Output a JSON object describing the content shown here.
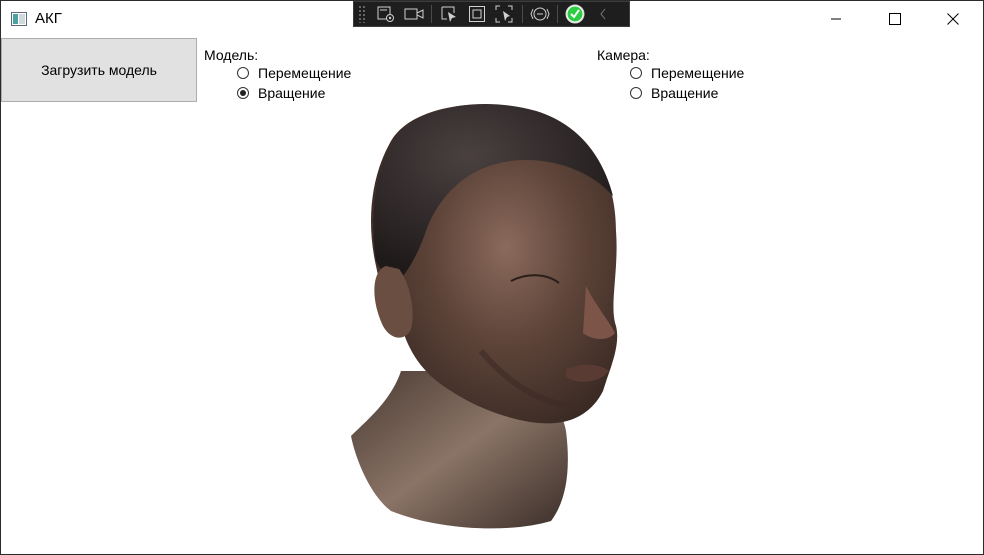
{
  "window": {
    "title": "АКГ",
    "controls": {
      "minimize": "minimize",
      "maximize": "maximize",
      "close": "close"
    }
  },
  "debug_toolbar": {
    "buttons": [
      "live-visual-tree-icon",
      "video-camera-icon",
      "select-element-icon",
      "display-layout-adorners-icon",
      "track-focused-element-icon",
      "binding-failures-icon",
      "hot-reload-check-icon",
      "collapse-chevron-icon"
    ]
  },
  "load_button": {
    "label": "Загрузить модель"
  },
  "model_group": {
    "label": "Модель:",
    "options": [
      {
        "label": "Перемещение",
        "checked": false
      },
      {
        "label": "Вращение",
        "checked": true
      }
    ]
  },
  "camera_group": {
    "label": "Камера:",
    "options": [
      {
        "label": "Перемещение",
        "checked": false
      },
      {
        "label": "Вращение",
        "checked": false
      }
    ]
  },
  "viewport": {
    "content": "3d-head-model"
  },
  "colors": {
    "toolbar_bg": "#1e1e1e",
    "button_bg": "#e1e1e1",
    "accent_check": "#2ecc40"
  }
}
